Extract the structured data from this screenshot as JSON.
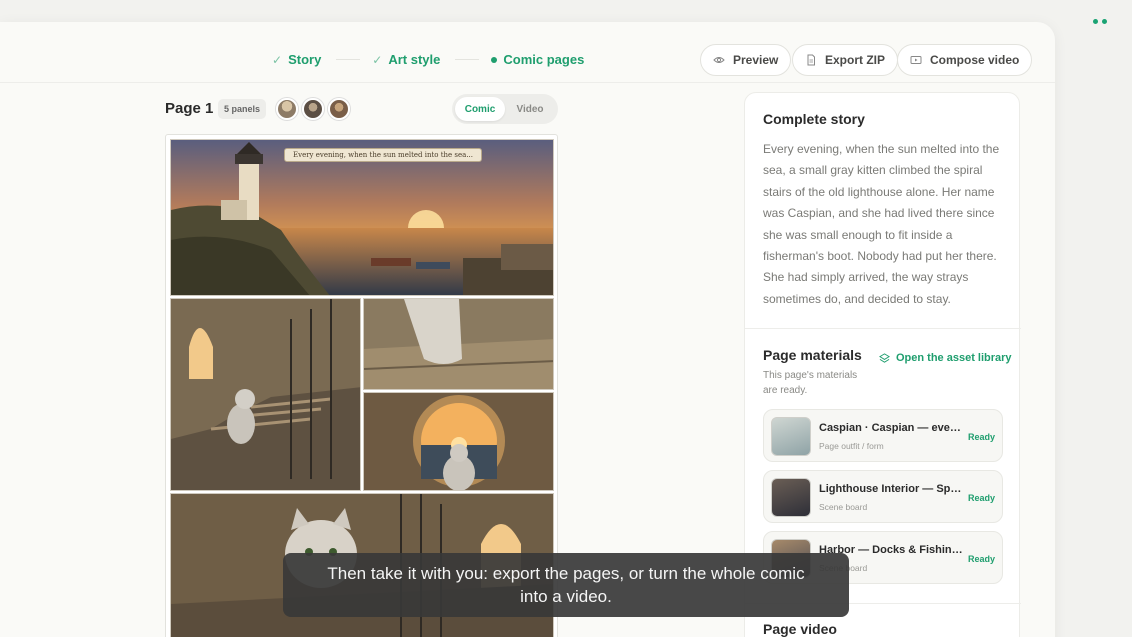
{
  "steps": [
    {
      "label": "Story",
      "state": "done"
    },
    {
      "label": "Art style",
      "state": "done"
    },
    {
      "label": "Comic pages",
      "state": "current"
    }
  ],
  "toolbar": {
    "preview_label": "Preview",
    "export_label": "Export ZIP",
    "compose_label": "Compose video"
  },
  "page": {
    "title": "Page 1",
    "panel_count": "5 panels",
    "view_options": [
      "Comic",
      "Video"
    ],
    "active_view": "Comic",
    "caption": "Every evening, when the sun melted into the sea..."
  },
  "story": {
    "title": "Complete story",
    "text": "Every evening, when the sun melted into the sea, a small gray kitten climbed the spiral stairs of the old lighthouse alone. Her name was Caspian, and she had lived there since she was small enough to fit inside a fisherman's boot. Nobody had put her there. She had simply arrived, the way strays sometimes do, and decided to stay."
  },
  "materials": {
    "title": "Page materials",
    "subtitle": "This page's materials are ready.",
    "library_link": "Open the asset library",
    "items": [
      {
        "name": "Caspian · Caspian — everyday look",
        "type": "Page outfit / form",
        "status": "Ready"
      },
      {
        "name": "Lighthouse Interior — Spiral Stairs",
        "type": "Scene board",
        "status": "Ready"
      },
      {
        "name": "Harbor — Docks & Fishing Boats",
        "type": "Scene board",
        "status": "Ready"
      }
    ]
  },
  "page_video": {
    "title": "Page video"
  },
  "subtitle_overlay": "Then take it with you: export the pages, or turn the whole comic into a video.",
  "colors": {
    "accent": "#1f9e6e",
    "background": "#f2f2ef"
  }
}
